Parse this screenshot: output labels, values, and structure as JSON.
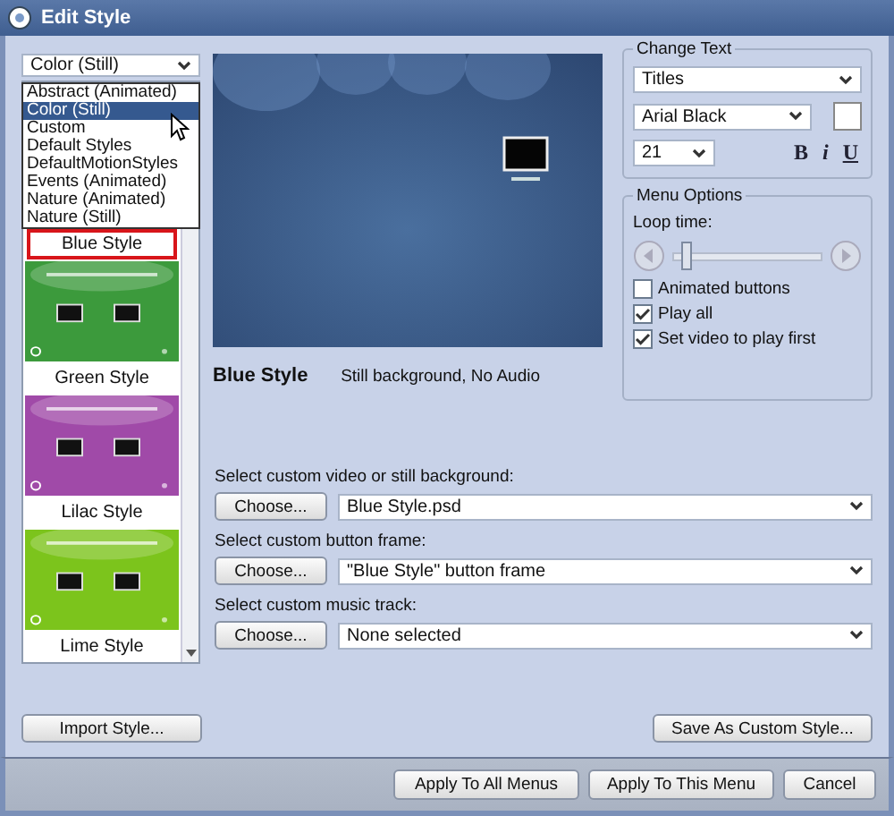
{
  "window": {
    "title": "Edit Style"
  },
  "category_select": {
    "value": "Color (Still)",
    "expanded": true,
    "options": [
      {
        "label": "Abstract (Animated)",
        "selected": false
      },
      {
        "label": "Color (Still)",
        "selected": true
      },
      {
        "label": "Custom",
        "selected": false
      },
      {
        "label": "Default Styles",
        "selected": false
      },
      {
        "label": "DefaultMotionStyles",
        "selected": false
      },
      {
        "label": "Events (Animated)",
        "selected": false
      },
      {
        "label": "Nature (Animated)",
        "selected": false
      },
      {
        "label": "Nature (Still)",
        "selected": false
      }
    ]
  },
  "styles": [
    {
      "name": "Blue Style",
      "selected": true
    },
    {
      "name": "Green Style",
      "selected": false,
      "color": "#3c9a3c"
    },
    {
      "name": "Lilac Style",
      "selected": false,
      "color": "#a04aa8"
    },
    {
      "name": "Lime Style",
      "selected": false,
      "color": "#7cc41c"
    }
  ],
  "preview": {
    "style_name": "Blue Style",
    "description": "Still background, No Audio"
  },
  "change_text": {
    "title": "Change Text",
    "target": "Titles",
    "font": "Arial Black",
    "size": "21",
    "bold": "B",
    "italic": "i",
    "underline": "U"
  },
  "menu_options": {
    "title": "Menu Options",
    "loop_label": "Loop time:",
    "loop_slider": {
      "level": 0.05
    },
    "options": [
      {
        "label": "Animated buttons",
        "checked": false
      },
      {
        "label": "Play all",
        "checked": true
      },
      {
        "label": "Set video to play first",
        "checked": true
      }
    ]
  },
  "sources": [
    {
      "label": "Select custom video or still background:",
      "button": "Choose...",
      "value": "Blue Style.psd"
    },
    {
      "label": "Select custom button frame:",
      "button": "Choose...",
      "value": "\"Blue Style\" button frame"
    },
    {
      "label": "Select custom music track:",
      "button": "Choose...",
      "value": "None selected"
    }
  ],
  "import_button": "Import Style...",
  "save_button": "Save As Custom Style...",
  "footer_buttons": [
    "Apply To All Menus",
    "Apply To This Menu",
    "Cancel"
  ]
}
